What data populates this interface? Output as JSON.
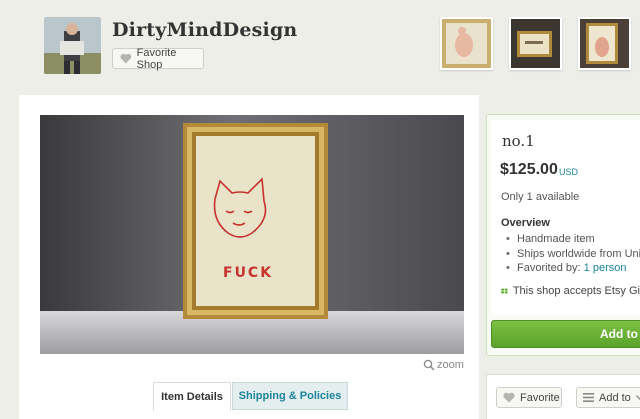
{
  "shop": {
    "name": "DirtyMindDesign",
    "favorite_label": "Favorite Shop"
  },
  "listing": {
    "title": "no.1",
    "price": "$125.00",
    "currency": "USD",
    "availability": "Only 1 available",
    "overview_heading": "Overview",
    "overview_items": [
      "Handmade item",
      "Ships worldwide from Unite"
    ],
    "favorited_label": "Favorited by:",
    "favorited_count": "1 person",
    "gift_card_text": "This shop accepts Etsy Gi",
    "add_to_cart_label": "Add to c",
    "embroidery_text": "FUCK"
  },
  "image_tools": {
    "zoom_label": "zoom"
  },
  "tabs": [
    {
      "label": "Item Details",
      "active": true
    },
    {
      "label": "Shipping & Policies",
      "active": false
    }
  ],
  "actions": {
    "favorite_label": "Favorite",
    "add_to_label": "Add to"
  },
  "colors": {
    "accent": "#1a8499",
    "cart_green": "#5aa32a",
    "page_bg": "#eeeee9"
  },
  "icons": [
    "heart-icon",
    "magnifier-icon",
    "gift-card-icon",
    "list-icon",
    "chevron-down-icon"
  ]
}
